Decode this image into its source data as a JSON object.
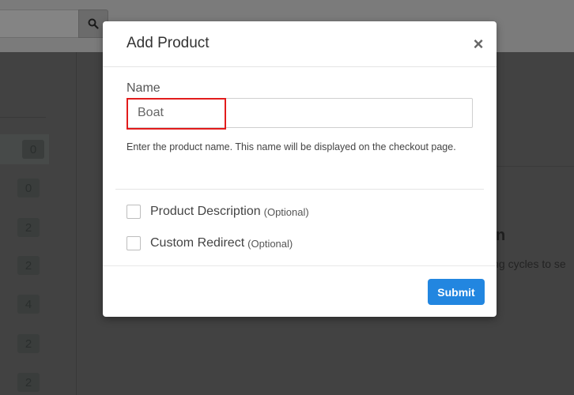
{
  "background": {
    "counts": [
      "0",
      "0",
      "2",
      "2",
      "4",
      "2",
      "2"
    ],
    "heading_fragment": "n",
    "text_fragment": "ing cycles to se"
  },
  "modal": {
    "title": "Add Product",
    "close_symbol": "×",
    "name_label": "Name",
    "name_value": "Boat",
    "help_text": "Enter the product name. This name will be displayed on the checkout page.",
    "options": [
      {
        "label": "Product Description",
        "optional": "(Optional)"
      },
      {
        "label": "Custom Redirect",
        "optional": "(Optional)"
      }
    ],
    "submit_label": "Submit"
  },
  "colors": {
    "accent": "#2286e0",
    "highlight": "#e21c1c"
  },
  "icons": {
    "search": "search-icon",
    "close": "close-icon"
  }
}
